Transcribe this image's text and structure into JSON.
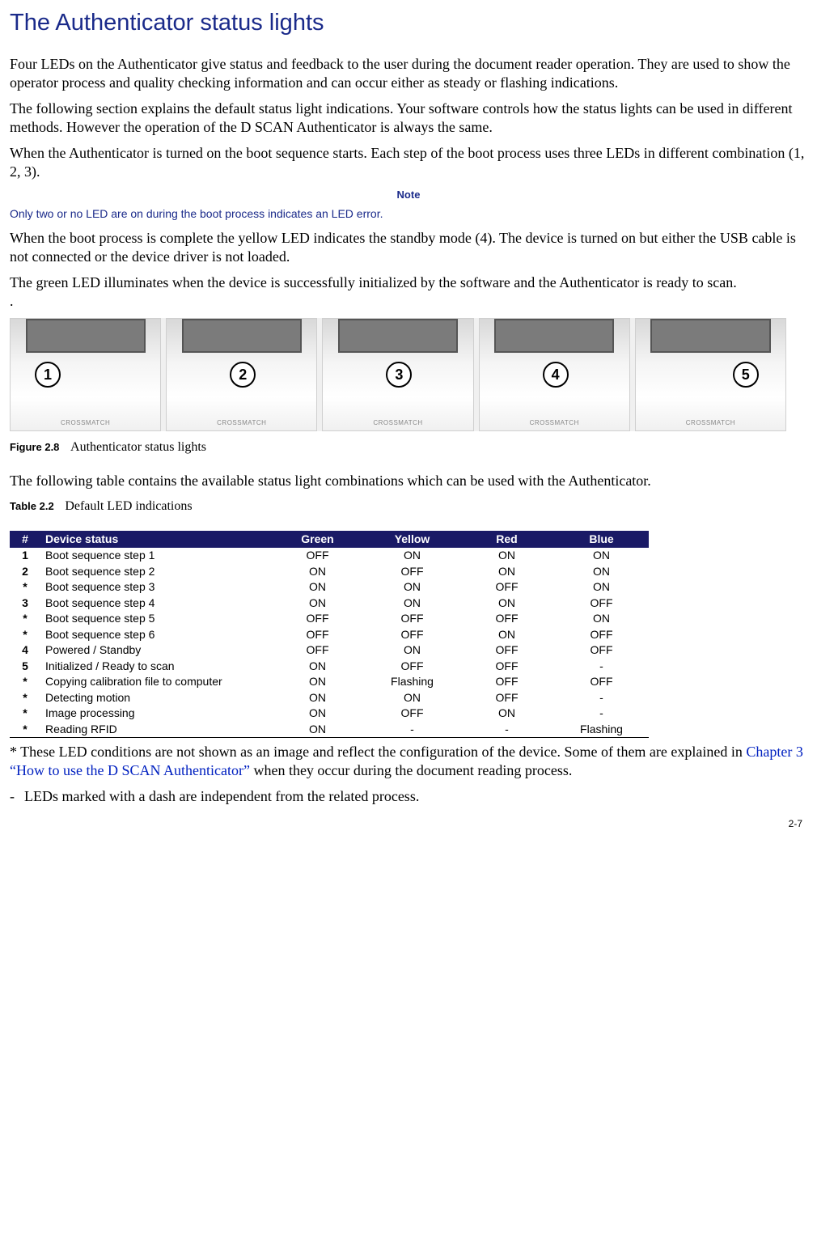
{
  "title": "The Authenticator status lights",
  "para1": "Four LEDs on the Authenticator give status and feedback to the user during the document reader operation. They are used to show the operator process and quality checking information and can occur either as steady or flashing indications.",
  "para2": "The following section explains the default status light indications. Your software controls how the status lights can be used in different methods. However the operation of the D SCAN Authenticator is always the same.",
  "para3": "When the Authenticator is turned on the boot sequence starts. Each step of the boot process uses three LEDs in different combination (1, 2, 3).",
  "note_label": "Note",
  "note_body": "Only two or no LED are on during the boot process indicates an LED error.",
  "para4": "When the boot process is complete the yellow LED indicates the standby mode (4). The device is turned on but either the USB cable is not connected or the device driver is not loaded.",
  "para5": "The green LED illuminates when the device is successfully initialized by the software and the Authenticator is ready to scan.",
  "para5_dot": ".",
  "brand": "CROSSMATCH",
  "callouts": [
    "1",
    "2",
    "3",
    "4",
    "5"
  ],
  "figure_num": "Figure 2.8",
  "figure_desc": "Authenticator status lights",
  "para6": "The following table contains the available status light combinations which can be used with the Authenticator.",
  "table_num": "Table 2.2",
  "table_desc": "Default LED indications",
  "headers": {
    "idx": "#",
    "status": "Device status",
    "green": "Green",
    "yellow": "Yellow",
    "red": "Red",
    "blue": "Blue"
  },
  "rows": [
    {
      "idx": "1",
      "status": "Boot sequence step 1",
      "green": "OFF",
      "yellow": "ON",
      "red": "ON",
      "blue": "ON"
    },
    {
      "idx": "2",
      "status": "Boot sequence step 2",
      "green": "ON",
      "yellow": "OFF",
      "red": "ON",
      "blue": "ON"
    },
    {
      "idx": "*",
      "status": "Boot sequence step 3",
      "green": "ON",
      "yellow": "ON",
      "red": "OFF",
      "blue": "ON"
    },
    {
      "idx": "3",
      "status": "Boot sequence step 4",
      "green": "ON",
      "yellow": "ON",
      "red": "ON",
      "blue": "OFF"
    },
    {
      "idx": "*",
      "status": "Boot sequence step 5",
      "green": "OFF",
      "yellow": "OFF",
      "red": "OFF",
      "blue": "ON"
    },
    {
      "idx": "*",
      "status": "Boot sequence step 6",
      "green": "OFF",
      "yellow": "OFF",
      "red": "ON",
      "blue": "OFF"
    },
    {
      "idx": "4",
      "status": "Powered / Standby",
      "green": "OFF",
      "yellow": "ON",
      "red": "OFF",
      "blue": "OFF"
    },
    {
      "idx": "5",
      "status": "Initialized / Ready to scan",
      "green": "ON",
      "yellow": "OFF",
      "red": "OFF",
      "blue": "-"
    },
    {
      "idx": "*",
      "status": "Copying calibration file to computer",
      "green": "ON",
      "yellow": "Flashing",
      "red": "OFF",
      "blue": "OFF"
    },
    {
      "idx": "*",
      "status": "Detecting motion",
      "green": "ON",
      "yellow": "ON",
      "red": "OFF",
      "blue": "-"
    },
    {
      "idx": "*",
      "status": "Image processing",
      "green": "ON",
      "yellow": "OFF",
      "red": "ON",
      "blue": "-"
    },
    {
      "idx": "*",
      "status": "Reading RFID",
      "green": "ON",
      "yellow": "-",
      "red": "-",
      "blue": "Flashing"
    }
  ],
  "footnote_prefix": "* These LED conditions are not shown as an image and reflect the configuration of the  device. Some of them are explained in ",
  "footnote_xref": "Chapter 3  “How to use the D SCAN Authenticator”",
  "footnote_suffix": " when they occur during the document reading process.",
  "dashline_dash": "-",
  "dashline_text": "LEDs marked with a dash are independent from the related process.",
  "page_number": "2-7"
}
